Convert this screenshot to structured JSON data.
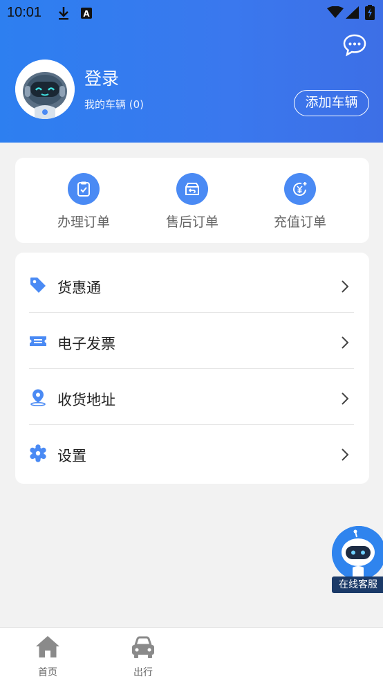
{
  "status_bar": {
    "time": "10:01"
  },
  "profile": {
    "title": "登录",
    "vehicle_count": "我的车辆 (0)",
    "add_vehicle_label": "添加车辆"
  },
  "orders": [
    {
      "label": "办理订单",
      "icon": "clipboard-check-icon"
    },
    {
      "label": "售后订单",
      "icon": "return-box-icon"
    },
    {
      "label": "充值订单",
      "icon": "yen-refresh-icon"
    }
  ],
  "menu": [
    {
      "label": "货惠通",
      "icon": "tag-icon"
    },
    {
      "label": "电子发票",
      "icon": "ticket-icon"
    },
    {
      "label": "收货地址",
      "icon": "location-pin-icon"
    },
    {
      "label": "设置",
      "icon": "gear-icon"
    }
  ],
  "customer_service": {
    "label": "在线客服"
  },
  "tabbar": [
    {
      "label": "首页",
      "icon": "home-icon"
    },
    {
      "label": "出行",
      "icon": "car-icon"
    }
  ],
  "colors": {
    "accent": "#3a7df0",
    "icon_blue": "#4a8af4",
    "background": "#f2f2f2"
  }
}
